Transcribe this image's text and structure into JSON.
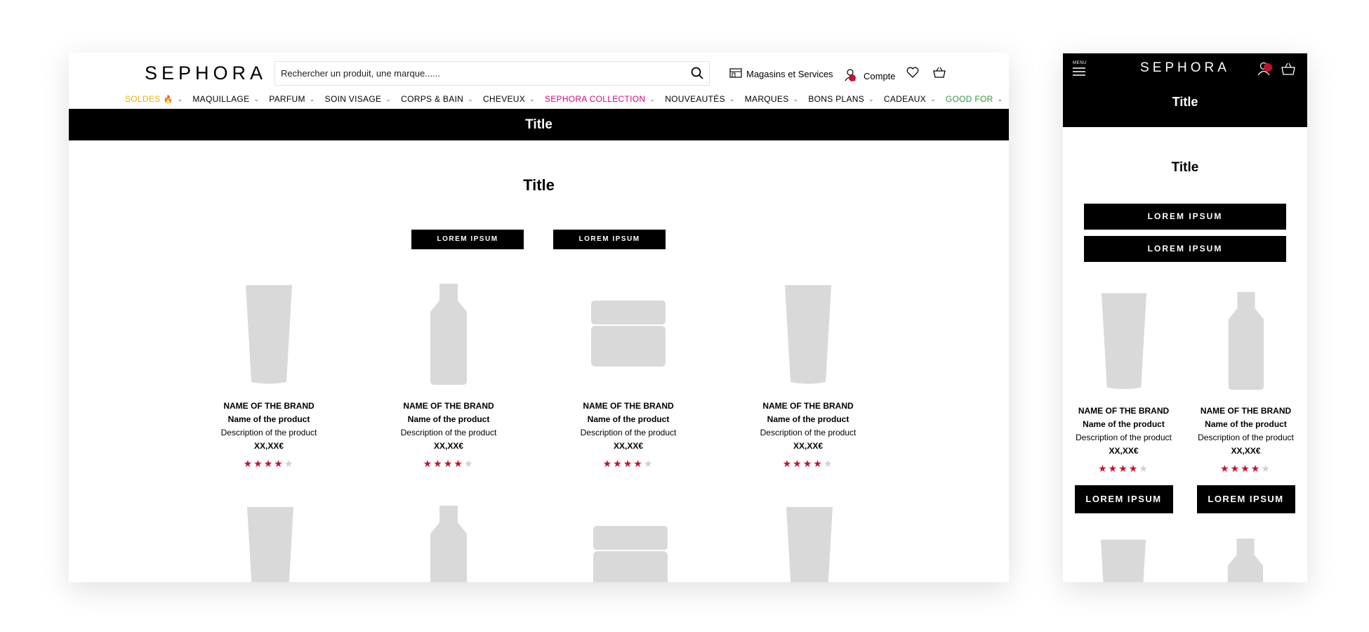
{
  "brand_logo": "SEPHORA",
  "search": {
    "placeholder": "Rechercher un produit, une marque......"
  },
  "header_links": {
    "stores": "Magasins et Services",
    "account": "Compte"
  },
  "nav": [
    {
      "label": "SOLDES",
      "emoji": "🔥",
      "color": "#f2b000"
    },
    {
      "label": "MAQUILLAGE",
      "color": "#000000"
    },
    {
      "label": "PARFUM",
      "color": "#000000"
    },
    {
      "label": "SOIN VISAGE",
      "color": "#000000"
    },
    {
      "label": "CORPS & BAIN",
      "color": "#000000"
    },
    {
      "label": "CHEVEUX",
      "color": "#000000"
    },
    {
      "label": "SEPHORA COLLECTION",
      "color": "#e2007a"
    },
    {
      "label": "NOUVEAUTÉS",
      "color": "#000000"
    },
    {
      "label": "MARQUES",
      "color": "#000000"
    },
    {
      "label": "BONS PLANS",
      "color": "#000000"
    },
    {
      "label": "CADEAUX",
      "color": "#000000"
    },
    {
      "label": "GOOD FOR",
      "color": "#2e9b3a"
    }
  ],
  "banner_title": "Title",
  "section_title": "Title",
  "buttons": [
    "LOREM IPSUM",
    "LOREM IPSUM"
  ],
  "products": [
    {
      "brand": "NAME OF THE BRAND",
      "name": "Name of the product",
      "description": "Description of the product",
      "price": "XX,XX€",
      "rating": 4,
      "shape": "tube"
    },
    {
      "brand": "NAME OF THE BRAND",
      "name": "Name of the product",
      "description": "Description of the product",
      "price": "XX,XX€",
      "rating": 4,
      "shape": "bottle"
    },
    {
      "brand": "NAME OF THE BRAND",
      "name": "Name of the product",
      "description": "Description of the product",
      "price": "XX,XX€",
      "rating": 4,
      "shape": "jar"
    },
    {
      "brand": "NAME OF THE BRAND",
      "name": "Name of the product",
      "description": "Description of the product",
      "price": "XX,XX€",
      "rating": 4,
      "shape": "tube"
    }
  ],
  "mobile": {
    "menu_label": "MENU",
    "logo": "SEPHORA",
    "banner_title": "Title",
    "section_title": "Title",
    "buttons": [
      "LOREM IPSUM",
      "LOREM IPSUM"
    ],
    "products": [
      {
        "brand": "NAME OF THE BRAND",
        "name": "Name of the product",
        "description": "Description of the product",
        "price": "XX,XX€",
        "rating": 4,
        "cta": "LOREM IPSUM",
        "shape": "tube"
      },
      {
        "brand": "NAME OF THE BRAND",
        "name": "Name of the product",
        "description": "Description of the product",
        "price": "XX,XX€",
        "rating": 4,
        "cta": "LOREM IPSUM",
        "shape": "bottle"
      }
    ]
  },
  "colors": {
    "star": "#c8102e",
    "placeholder_product": "#d9d9d9",
    "notification_dot": "#c8102e"
  }
}
